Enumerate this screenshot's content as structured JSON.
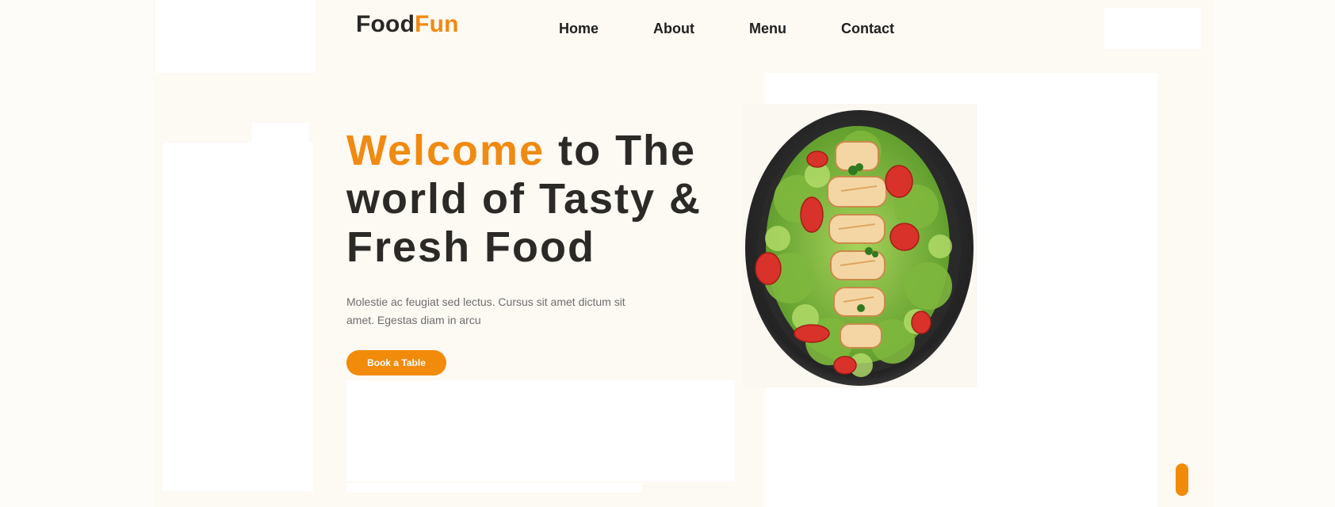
{
  "header": {
    "logo_primary": "Food",
    "logo_accent": "Fun",
    "nav": [
      {
        "label": "Home"
      },
      {
        "label": "About"
      },
      {
        "label": "Menu"
      },
      {
        "label": "Contact"
      }
    ]
  },
  "hero": {
    "title_accent": "Welcome",
    "title_rest": " to The world of Tasty & Fresh Food",
    "description": "Molestie ac feugiat sed lectus. Cursus sit amet dictum sit amet. Egestas diam in arcu",
    "cta_label": "Book a Table",
    "image_icon": "salad-plate-image"
  },
  "scroll_control": {
    "icon": "scroll-to-top-icon"
  },
  "colors": {
    "accent": "#f08a11",
    "text_dark": "#2c2a27",
    "text_muted": "#6e6e6e",
    "background": "#fefcf8"
  }
}
